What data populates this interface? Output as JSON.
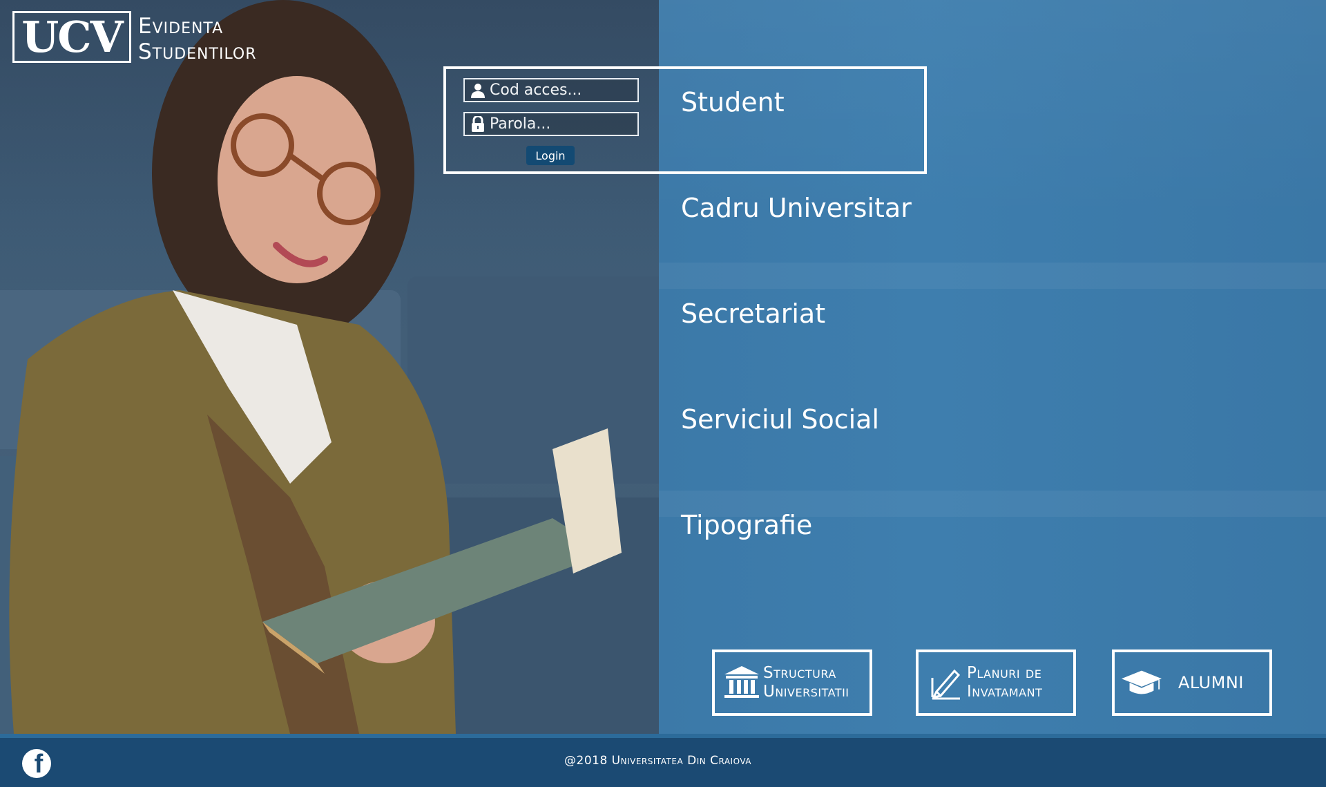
{
  "header": {
    "logo_mark": "UCV",
    "title_line1": "Evidenta",
    "title_line2": "Studentilor"
  },
  "login": {
    "code_placeholder": "Cod acces...",
    "password_placeholder": "Parola...",
    "button_label": "Login",
    "user_icon": "user-icon",
    "lock_icon": "lock-icon"
  },
  "roles": [
    {
      "label": "Student"
    },
    {
      "label": "Cadru Universitar"
    },
    {
      "label": "Secretariat"
    },
    {
      "label": "Serviciul Social"
    },
    {
      "label": "Tipografie"
    }
  ],
  "tiles": [
    {
      "icon": "university-building-icon",
      "line1": "Structura",
      "line2": "Universitatii"
    },
    {
      "icon": "pencil-edit-icon",
      "line1": "Planuri de",
      "line2": "Invatamant"
    },
    {
      "icon": "graduation-cap-icon",
      "line1": "ALUMNI",
      "line2": ""
    }
  ],
  "footer": {
    "facebook_icon": "facebook-icon",
    "copyright": "@2018 Universitatea Din Craiova"
  },
  "colors": {
    "panel_blue": "#3c79a8",
    "footer_blue": "#1b4a73",
    "button_blue": "#134a73"
  }
}
